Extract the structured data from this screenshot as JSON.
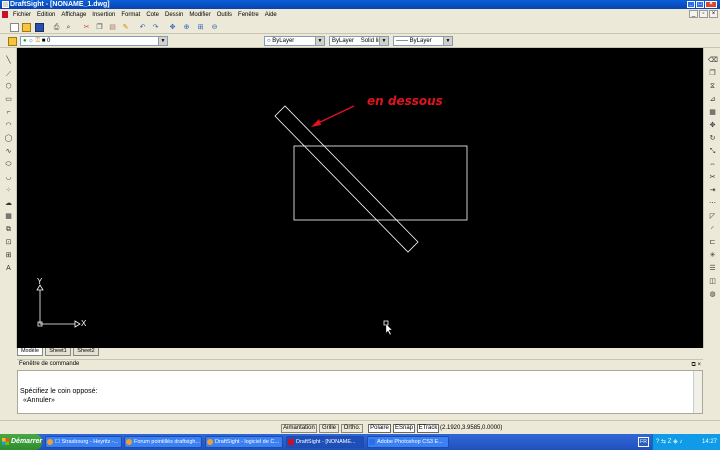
{
  "window": {
    "title": "DraftSight - [NONAME_1.dwg]"
  },
  "menu": [
    "Fichier",
    "Edition",
    "Affichage",
    "Insertion",
    "Format",
    "Cote",
    "Dessin",
    "Modifier",
    "Outils",
    "Fenêtre",
    "Aide"
  ],
  "toolbar": {
    "layer_value": "0",
    "color_value": "ByLayer",
    "linestyle_value": "ByLayer",
    "linestyle_name": "Solid line",
    "lineweight_value": "—— ByLayer"
  },
  "canvas": {
    "annotation": "en dessous",
    "annotation_color": "#e0141e",
    "background": "#000000",
    "axis_x_label": "X",
    "axis_y_label": "Y"
  },
  "tabs": [
    "Modèle",
    "Sheet1",
    "Sheet2"
  ],
  "command": {
    "header": "Fenêtre de commande",
    "line1": "Spécifiez le coin opposé:",
    "line2": "«Annuler»"
  },
  "status": {
    "buttons": [
      {
        "label": "Aimantation",
        "on": false
      },
      {
        "label": "Grille",
        "on": false
      },
      {
        "label": "Ortho.",
        "on": false
      },
      {
        "label": "Polaire",
        "on": true
      },
      {
        "label": "ESnap",
        "on": true
      },
      {
        "label": "ETrack",
        "on": true
      }
    ],
    "coords": "(2.1920,3.9585,0.0000)"
  },
  "taskbar": {
    "start": "Démarrer",
    "tasks": [
      {
        "label": "☐ Strasbourg - Heyritz -..."
      },
      {
        "label": "Forum pointillés draftsigh..."
      },
      {
        "label": "DraftSight - logiciel de C..."
      },
      {
        "label": "DraftSight - [NONAME..."
      },
      {
        "label": "Adobe Photoshop CS3 E..."
      }
    ],
    "lang": "FR",
    "clock": "14:27"
  }
}
